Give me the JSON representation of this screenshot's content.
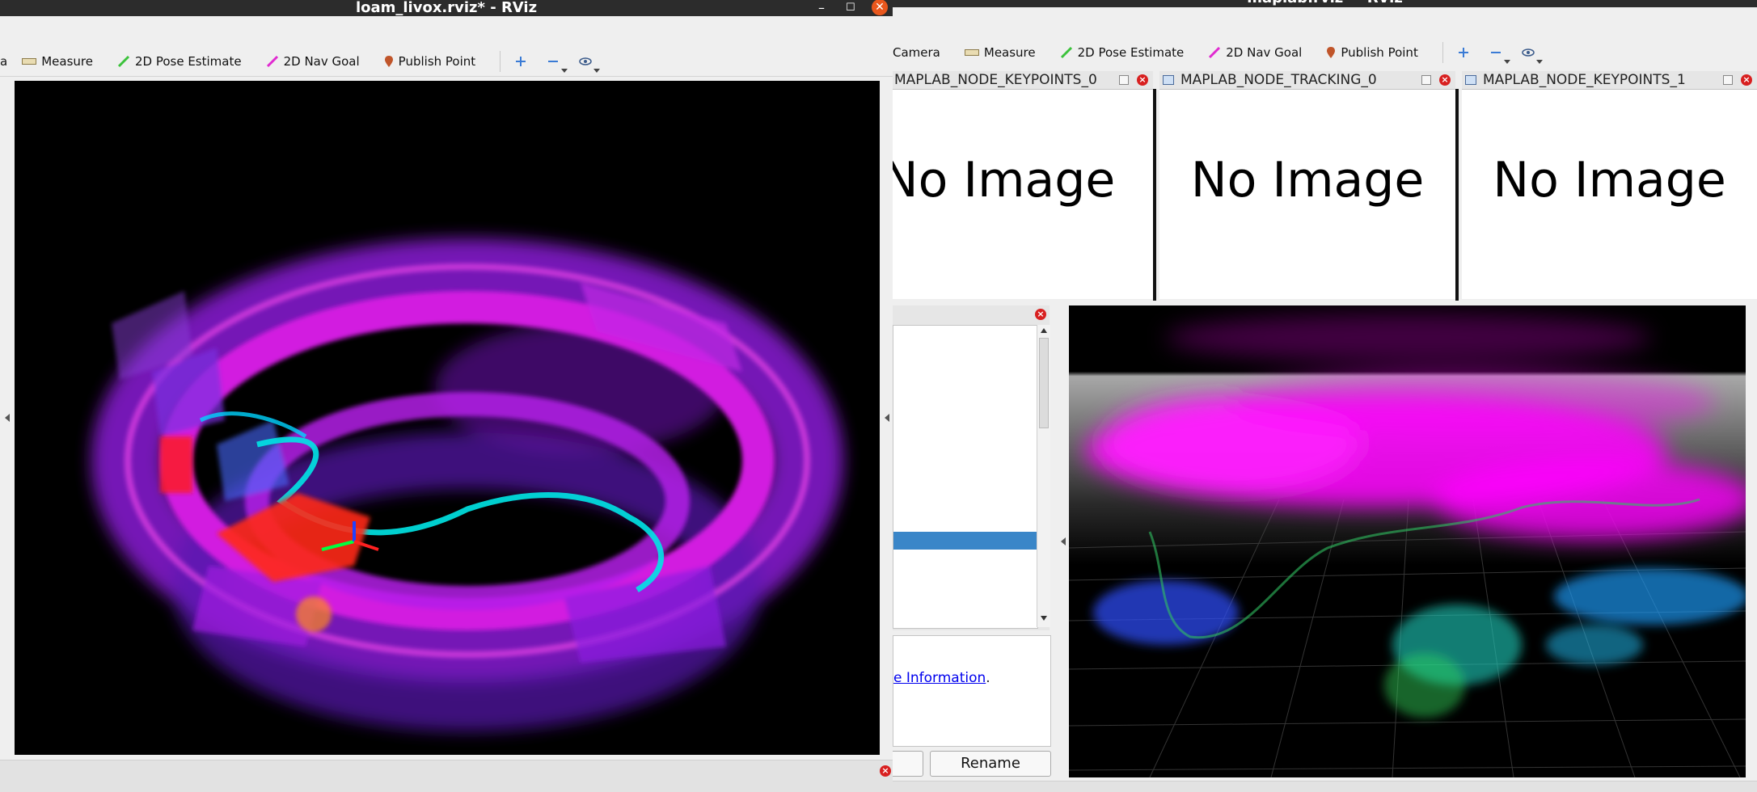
{
  "left_window": {
    "title": "loam_livox.rviz* - RViz",
    "toolbar": {
      "partial_label": "a",
      "measure": "Measure",
      "pose_estimate": "2D Pose Estimate",
      "nav_goal": "2D Nav Goal",
      "publish_point": "Publish Point"
    }
  },
  "right_window": {
    "title": "maplab.rviz* - RViz",
    "toolbar": {
      "camera": "Camera",
      "measure": "Measure",
      "pose_estimate": "2D Pose Estimate",
      "nav_goal": "2D Nav Goal",
      "publish_point": "Publish Point"
    },
    "image_panels": [
      {
        "title": "MAPLAB_NODE_KEYPOINTS_0",
        "message": "No Image"
      },
      {
        "title": "MAPLAB_NODE_TRACKING_0",
        "message": "No Image"
      },
      {
        "title": "MAPLAB_NODE_KEYPOINTS_1",
        "message": "No Image"
      }
    ],
    "help_link": "e Information",
    "help_punct": ".",
    "rename_button": "Rename"
  },
  "colors": {
    "accent_selection": "#3a86c8",
    "titlebar": "#2c2c2c",
    "close_button": "#e8571d",
    "point_magenta": "#ff00ff",
    "point_cyan": "#00e0e0"
  },
  "icons": {
    "measure": "ruler-icon",
    "pose_estimate": "green-arrow-icon",
    "nav_goal": "magenta-arrow-icon",
    "publish_point": "map-pin-icon",
    "zoom_in": "plus-icon",
    "zoom_out": "minus-icon",
    "view": "eye-icon"
  }
}
